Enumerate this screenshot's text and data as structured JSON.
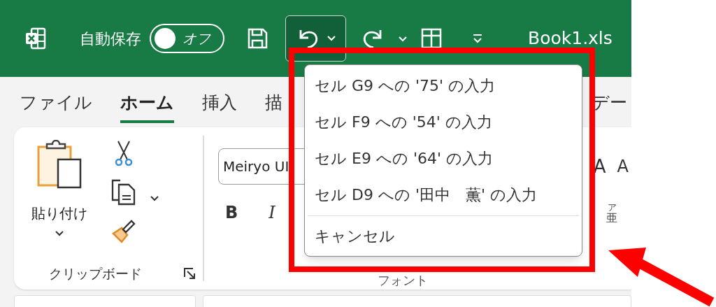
{
  "title_bar": {
    "autosave_label": "自動保存",
    "autosave_toggle": {
      "label": "オフ",
      "on": false
    },
    "undo_button": {
      "open": true
    },
    "file_name": "Book1.xls"
  },
  "tabs": [
    {
      "label": "ファイル",
      "selected": false
    },
    {
      "label": "ホーム",
      "selected": true
    },
    {
      "label": "挿入",
      "selected": false
    },
    {
      "label": "描",
      "selected": false
    },
    {
      "label": "デー",
      "selected": false
    }
  ],
  "ribbon": {
    "clipboard": {
      "paste_label": "貼り付け",
      "group_label": "クリップボード"
    },
    "font": {
      "font_name": "Meiryo UI",
      "bold": "B",
      "italic": "I",
      "grow_font": "A",
      "shrink_font": "A",
      "phonetic_top": "ア",
      "phonetic_bottom": "亜",
      "group_label": "フォント"
    }
  },
  "undo_menu": {
    "items": [
      "セル G9 への '75' の入力",
      "セル F9 への '54' の入力",
      "セル E9 への '64' の入力",
      "セル D9 への '田中　薫' の入力"
    ],
    "cancel": "キャンセル"
  }
}
